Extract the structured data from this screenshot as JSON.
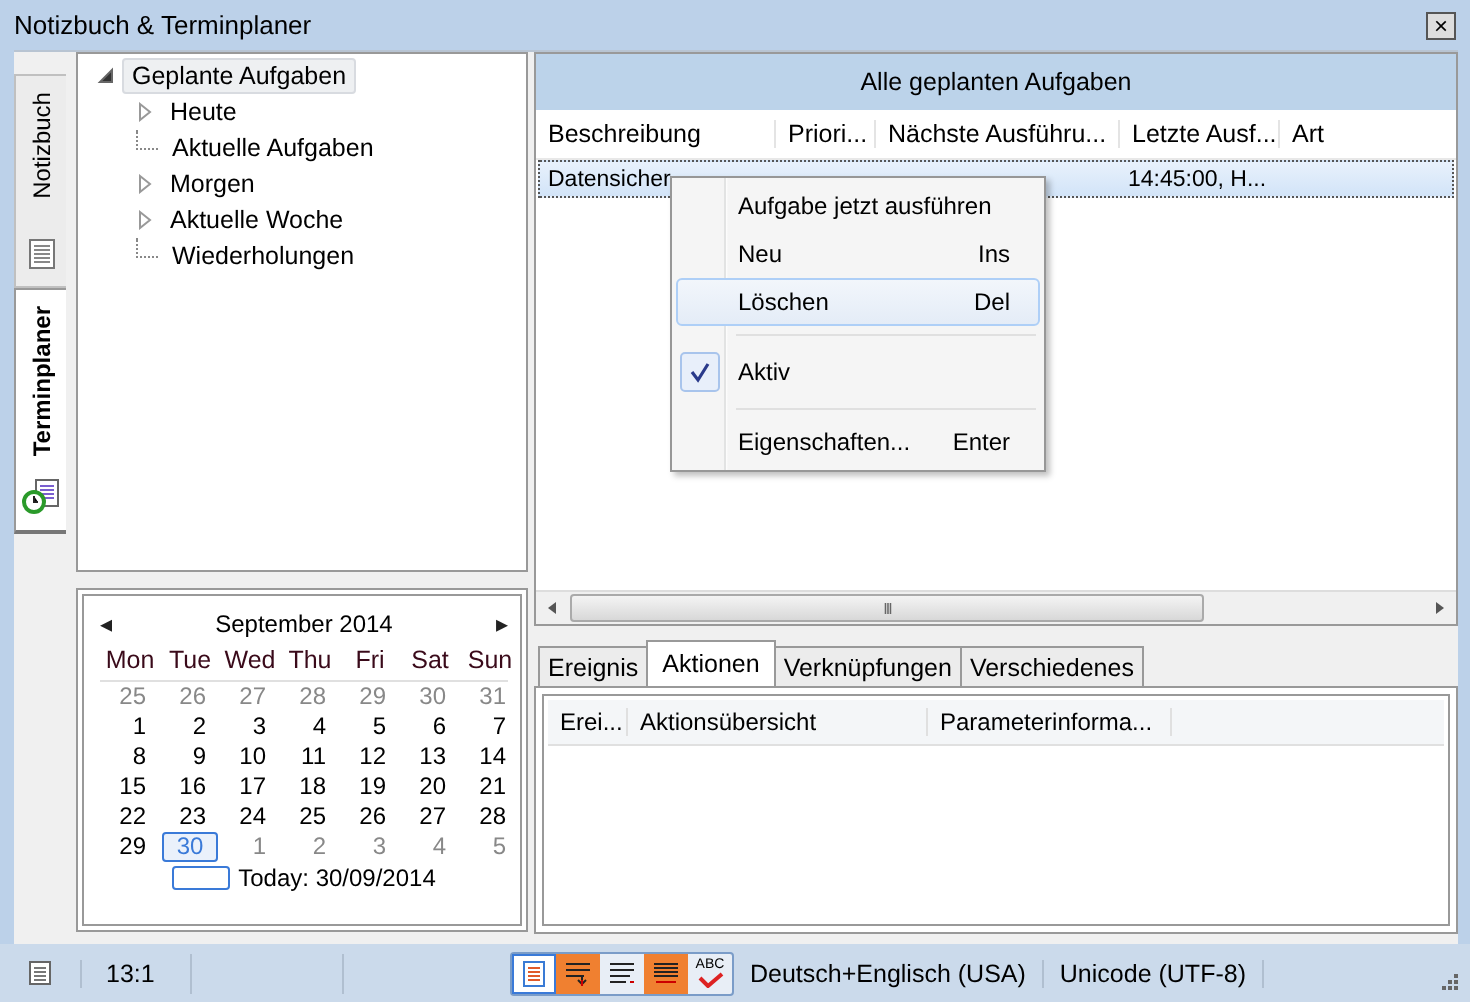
{
  "window": {
    "title": "Notizbuch & Terminplaner",
    "close": "×"
  },
  "side_tabs": [
    {
      "label": "Notizbuch",
      "selected": false
    },
    {
      "label": "Terminplaner",
      "selected": true
    }
  ],
  "tree": {
    "label": "Geplante Aufgaben",
    "expanded": true,
    "selected": true,
    "children": [
      {
        "label": "Heute",
        "expanded": false
      },
      {
        "label": "Aktuelle Aufgaben"
      },
      {
        "label": "Morgen",
        "expanded": false
      },
      {
        "label": "Aktuelle Woche",
        "expanded": false
      },
      {
        "label": "Wiederholungen"
      }
    ]
  },
  "calendar": {
    "prev": "◂",
    "next": "▸",
    "month": "September 2014",
    "weekdays": [
      "Mon",
      "Tue",
      "Wed",
      "Thu",
      "Fri",
      "Sat",
      "Sun"
    ],
    "weeks": [
      [
        {
          "d": "25",
          "other": true,
          "selected": false
        },
        {
          "d": "26",
          "other": true,
          "selected": false
        },
        {
          "d": "27",
          "other": true,
          "selected": false
        },
        {
          "d": "28",
          "other": true,
          "selected": false
        },
        {
          "d": "29",
          "other": true,
          "selected": false
        },
        {
          "d": "30",
          "other": true,
          "selected": false
        },
        {
          "d": "31",
          "other": true,
          "selected": false
        }
      ],
      [
        {
          "d": "1",
          "other": false,
          "selected": false
        },
        {
          "d": "2",
          "other": false,
          "selected": false
        },
        {
          "d": "3",
          "other": false,
          "selected": false
        },
        {
          "d": "4",
          "other": false,
          "selected": false
        },
        {
          "d": "5",
          "other": false,
          "selected": false
        },
        {
          "d": "6",
          "other": false,
          "selected": false
        },
        {
          "d": "7",
          "other": false,
          "selected": false
        }
      ],
      [
        {
          "d": "8",
          "other": false,
          "selected": false
        },
        {
          "d": "9",
          "other": false,
          "selected": false
        },
        {
          "d": "10",
          "other": false,
          "selected": false
        },
        {
          "d": "11",
          "other": false,
          "selected": false
        },
        {
          "d": "12",
          "other": false,
          "selected": false
        },
        {
          "d": "13",
          "other": false,
          "selected": false
        },
        {
          "d": "14",
          "other": false,
          "selected": false
        }
      ],
      [
        {
          "d": "15",
          "other": false,
          "selected": false
        },
        {
          "d": "16",
          "other": false,
          "selected": false
        },
        {
          "d": "17",
          "other": false,
          "selected": false
        },
        {
          "d": "18",
          "other": false,
          "selected": false
        },
        {
          "d": "19",
          "other": false,
          "selected": false
        },
        {
          "d": "20",
          "other": false,
          "selected": false
        },
        {
          "d": "21",
          "other": false,
          "selected": false
        }
      ],
      [
        {
          "d": "22",
          "other": false,
          "selected": false
        },
        {
          "d": "23",
          "other": false,
          "selected": false
        },
        {
          "d": "24",
          "other": false,
          "selected": false
        },
        {
          "d": "25",
          "other": false,
          "selected": false
        },
        {
          "d": "26",
          "other": false,
          "selected": false
        },
        {
          "d": "27",
          "other": false,
          "selected": false
        },
        {
          "d": "28",
          "other": false,
          "selected": false
        }
      ],
      [
        {
          "d": "29",
          "other": false,
          "selected": false
        },
        {
          "d": "30",
          "other": false,
          "selected": true
        },
        {
          "d": "1",
          "other": true,
          "selected": false
        },
        {
          "d": "2",
          "other": true,
          "selected": false
        },
        {
          "d": "3",
          "other": true,
          "selected": false
        },
        {
          "d": "4",
          "other": true,
          "selected": false
        },
        {
          "d": "5",
          "other": true,
          "selected": false
        }
      ]
    ],
    "today": "Today: 30/09/2014"
  },
  "tasks": {
    "title": "Alle geplanten Aufgaben",
    "columns": [
      "Beschreibung",
      "Priori...",
      "Nächste Ausführu...",
      "Letzte Ausf...",
      "Art"
    ],
    "rows": [
      {
        "selected": true,
        "cells": [
          "Datensicher",
          "",
          "",
          "14:45:00, H...",
          ""
        ]
      }
    ],
    "scroll": "III"
  },
  "context_menu": [
    {
      "kind": "item",
      "label": "Aufgabe jetzt ausführen",
      "selected": false,
      "checked": false
    },
    {
      "kind": "item",
      "label": "Neu",
      "shortcut": "Ins",
      "selected": false,
      "checked": false
    },
    {
      "kind": "item",
      "label": "Löschen",
      "shortcut": "Del",
      "selected": true,
      "checked": false
    },
    {
      "kind": "separator"
    },
    {
      "kind": "item",
      "label": "Aktiv",
      "selected": false,
      "checked": true
    },
    {
      "kind": "separator"
    },
    {
      "kind": "item",
      "label": "Eigenschaften...",
      "shortcut": "Enter",
      "selected": false,
      "checked": false
    }
  ],
  "detail_tabs": [
    {
      "label": "Ereignis",
      "selected": false
    },
    {
      "label": "Aktionen",
      "selected": true
    },
    {
      "label": "Verknüpfungen",
      "selected": false
    },
    {
      "label": "Verschiedenes",
      "selected": false
    }
  ],
  "actions_columns": [
    "Erei...",
    "Aktionsübersicht",
    "Parameterinforma..."
  ],
  "status_bar": {
    "position": "13:1",
    "tools": [
      {
        "on": false,
        "selected": true
      },
      {
        "on": true,
        "selected": false
      },
      {
        "on": false,
        "selected": false
      },
      {
        "on": true,
        "selected": false
      },
      {
        "on": false,
        "selected": false
      }
    ],
    "spell_label": "ABC",
    "language": "Deutsch+Englisch (USA)",
    "encoding": "Unicode (UTF-8)"
  }
}
